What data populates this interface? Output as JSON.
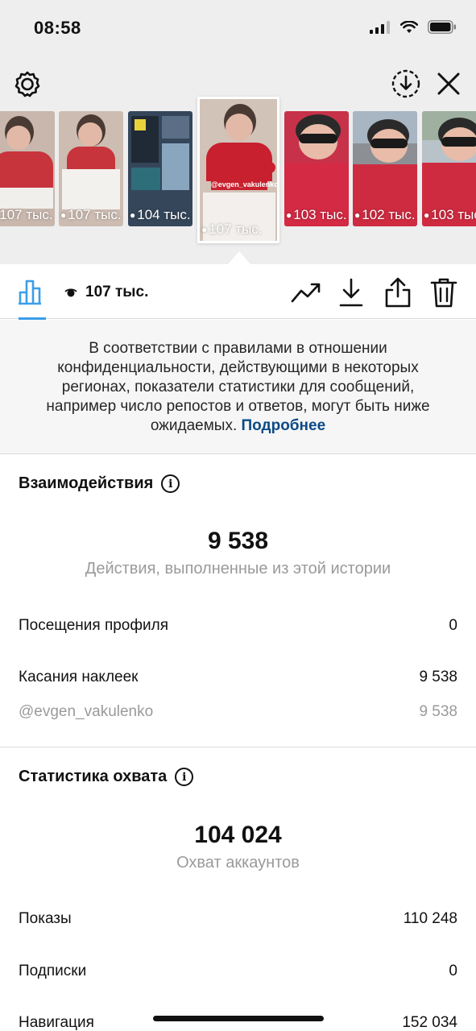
{
  "status_bar": {
    "time": "08:58"
  },
  "thumbnails": [
    {
      "views": "107 тыс.",
      "bg": "#c9b7ad",
      "accent": "#d12e36"
    },
    {
      "views": "107 тыс.",
      "bg": "#cdbcb2",
      "accent": "#d12e36"
    },
    {
      "views": "104 тыс.",
      "bg": "#35465a",
      "accent": "#e8d23a"
    },
    {
      "views": "107 тыс.",
      "bg": "#d2c3b9",
      "accent": "#c8202e",
      "selected": true,
      "handle": "@evgen_vakulenko"
    },
    {
      "views": "103 тыс.",
      "bg": "#c7324a",
      "accent": "#2a2a2a"
    },
    {
      "views": "102 тыс.",
      "bg": "#8c8f94",
      "accent": "#cf2b40"
    },
    {
      "views": "103 тыс.",
      "bg": "#b8c2c9",
      "accent": "#cf2b40"
    }
  ],
  "action_row": {
    "views": "107 тыс."
  },
  "notice": {
    "text": "В соответствии с правилами в отношении конфиденциальности, действующими в некоторых регионах, показатели статистики для сообщений, например число репостов и ответов, могут быть ниже ожидаемых.",
    "link": "Подробнее"
  },
  "interactions": {
    "title": "Взаимодействия",
    "total": "9 538",
    "caption": "Действия, выполненные из этой истории",
    "rows": [
      {
        "label": "Посещения профиля",
        "value": "0"
      },
      {
        "label": "Касания наклеек",
        "value": "9 538"
      },
      {
        "label": "@evgen_vakulenko",
        "value": "9 538"
      }
    ]
  },
  "reach": {
    "title": "Статистика охвата",
    "total": "104 024",
    "caption": "Охват аккаунтов",
    "rows": [
      {
        "label": "Показы",
        "value": "110 248"
      },
      {
        "label": "Подписки",
        "value": "0"
      },
      {
        "label": "Навигация",
        "value": "152 034"
      }
    ]
  },
  "icons": {
    "settings": "settings-gear-icon",
    "download_circle": "download-circle-icon",
    "close": "close-icon",
    "insights": "bar-chart-icon",
    "eye": "eye-icon",
    "trend": "trend-up-icon",
    "download": "download-icon",
    "share": "share-icon",
    "trash": "trash-icon",
    "info": "info-icon"
  }
}
